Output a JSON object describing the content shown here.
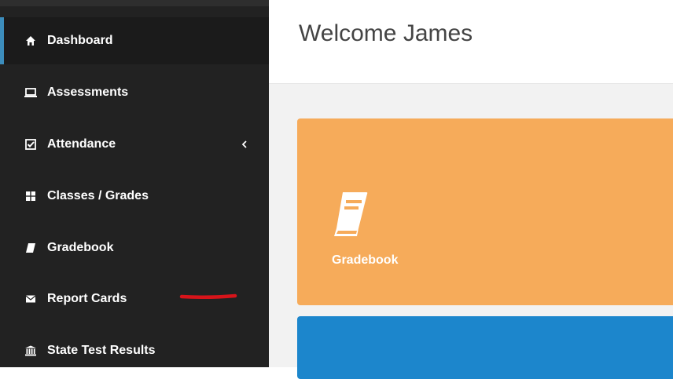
{
  "header": {
    "title": "Welcome James"
  },
  "sidebar": {
    "items": [
      {
        "label": "Dashboard",
        "icon": "home-icon",
        "active": true
      },
      {
        "label": "Assessments",
        "icon": "laptop-icon"
      },
      {
        "label": "Attendance",
        "icon": "check-square-icon",
        "has_submenu": true
      },
      {
        "label": "Classes / Grades",
        "icon": "grid-icon"
      },
      {
        "label": "Gradebook",
        "icon": "book-icon"
      },
      {
        "label": "Report Cards",
        "icon": "envelope-icon"
      },
      {
        "label": "State Test Results",
        "icon": "bank-icon"
      }
    ]
  },
  "tiles": [
    {
      "label": "Gradebook",
      "icon": "book-icon",
      "color": "#f6ab5a"
    },
    {
      "color": "#1c86cc"
    }
  ],
  "colors": {
    "sidebar_bg": "#222222",
    "active_indicator": "#3c8dbc",
    "annotation": "#d7141a"
  }
}
